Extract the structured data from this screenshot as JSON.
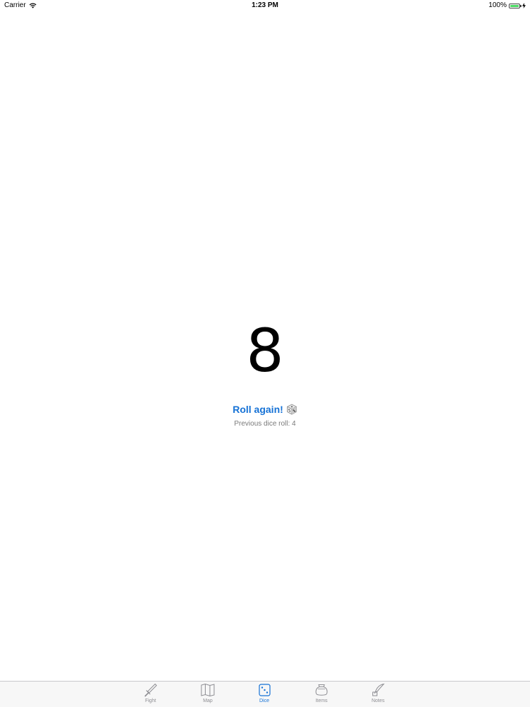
{
  "status_bar": {
    "carrier": "Carrier",
    "time": "1:23 PM",
    "battery": "100%",
    "battery_level": 1.0,
    "icons": [
      "wifi-icon",
      "battery-icon",
      "charging-icon"
    ]
  },
  "dice": {
    "result": "8",
    "roll_again_label": "Roll again!",
    "roll_again_icon": "die-icon",
    "previous_roll": "Previous dice roll: 4"
  },
  "tab_bar": {
    "active_tab": "Dice",
    "tabs": [
      {
        "label": "Fight",
        "icon": "sword-icon"
      },
      {
        "label": "Map",
        "icon": "map-icon"
      },
      {
        "label": "Dice",
        "icon": "dice-icon"
      },
      {
        "label": "Items",
        "icon": "bag-icon"
      },
      {
        "label": "Notes",
        "icon": "quill-icon"
      }
    ]
  },
  "colors": {
    "accent": "#1672d6",
    "inactive": "#8e8e93",
    "battery": "#4cd964",
    "background": "#ffffff",
    "tab_bar_background": "#f7f7f7"
  }
}
